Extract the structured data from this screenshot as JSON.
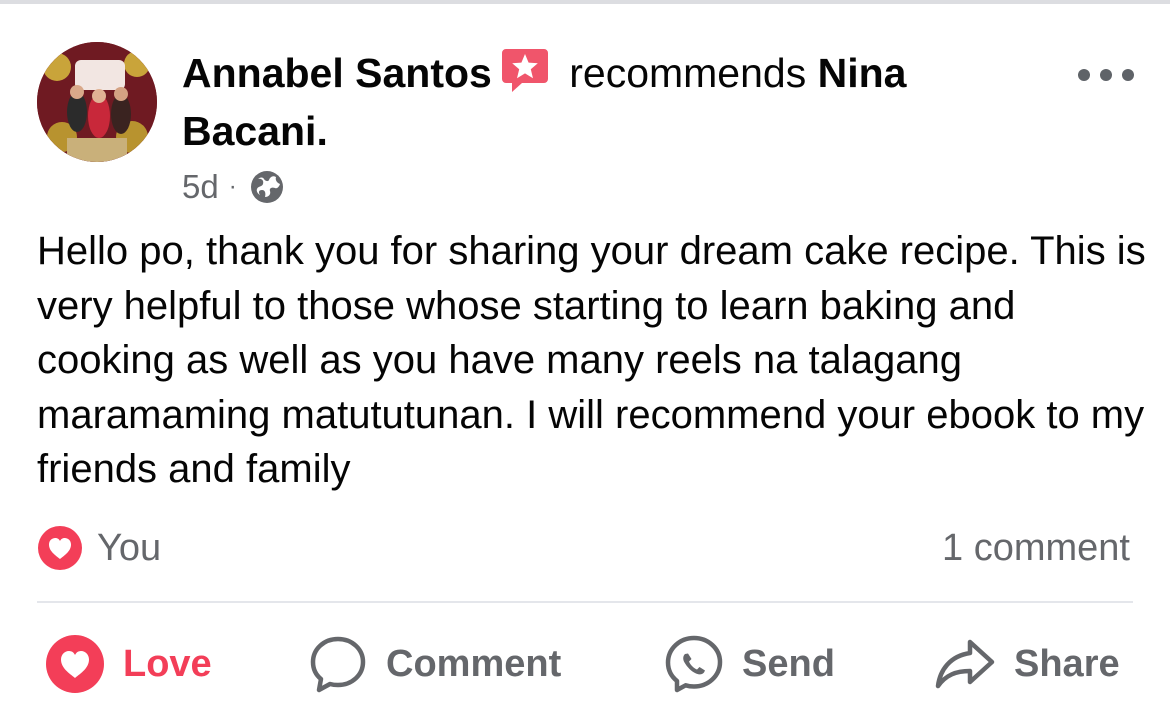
{
  "post": {
    "author": "Annabel Santos",
    "verb": "recommends",
    "target": "Nina Bacani.",
    "time": "5d",
    "separator": "·",
    "body": "Hello po, thank you for sharing your dream cake recipe. This is very helpful to those whose starting to learn baking and cooking as well as you have many reels na talagang maramaming matututunan. I will recommend your ebook to my friends and family",
    "reactions_label": "You",
    "comments_label": "1 comment"
  },
  "actions": {
    "love": "Love",
    "comment": "Comment",
    "send": "Send",
    "share": "Share"
  },
  "colors": {
    "love_red": "#f33e58",
    "secondary_text": "#65676b",
    "badge_red": "#f0556b"
  },
  "icons": {
    "badge": "recommend-star-badge-icon",
    "privacy": "globe-icon",
    "more": "more-options-icon",
    "reaction": "heart-icon",
    "comment": "comment-bubble-icon",
    "send": "messenger-icon",
    "share": "share-arrow-icon"
  }
}
